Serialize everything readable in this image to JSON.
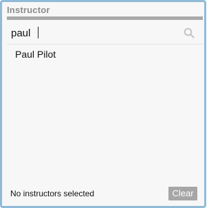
{
  "panel": {
    "title": "Instructor"
  },
  "search": {
    "value": "paul",
    "icon": "search-icon"
  },
  "results": [
    {
      "label": "Paul Pilot"
    }
  ],
  "footer": {
    "status": "No instructors selected",
    "clear_label": "Clear"
  },
  "colors": {
    "frame_border": "#8fbbd9",
    "title_rule": "#a9a9a9",
    "clear_button_bg": "#a6a6a6"
  }
}
